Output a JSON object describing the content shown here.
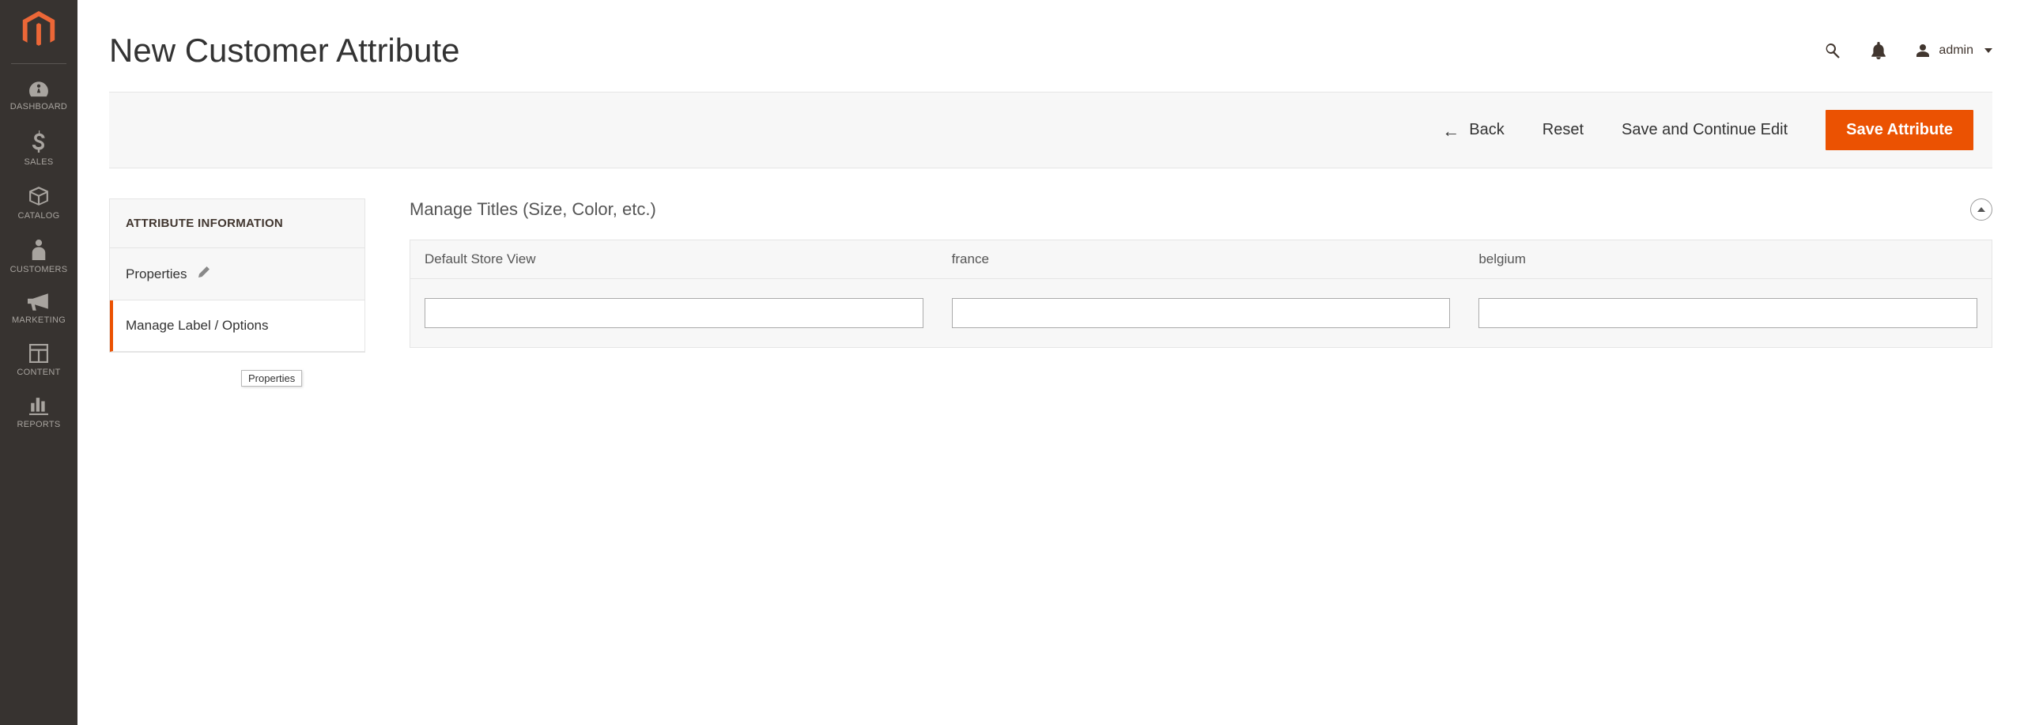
{
  "sidebar": {
    "items": [
      {
        "label": "DASHBOARD"
      },
      {
        "label": "SALES"
      },
      {
        "label": "CATALOG"
      },
      {
        "label": "CUSTOMERS"
      },
      {
        "label": "MARKETING"
      },
      {
        "label": "CONTENT"
      },
      {
        "label": "REPORTS"
      }
    ]
  },
  "header": {
    "title": "New Customer Attribute",
    "user_name": "admin"
  },
  "actions": {
    "back": "Back",
    "reset": "Reset",
    "save_continue": "Save and Continue Edit",
    "save": "Save Attribute"
  },
  "side_panel": {
    "title": "ATTRIBUTE INFORMATION",
    "tabs": {
      "properties": "Properties",
      "manage_label": "Manage Label / Options"
    },
    "tooltip": "Properties"
  },
  "section": {
    "title": "Manage Titles (Size, Color, etc.)",
    "columns": [
      {
        "label": "Default Store View",
        "value": ""
      },
      {
        "label": "france",
        "value": ""
      },
      {
        "label": "belgium",
        "value": ""
      }
    ]
  }
}
